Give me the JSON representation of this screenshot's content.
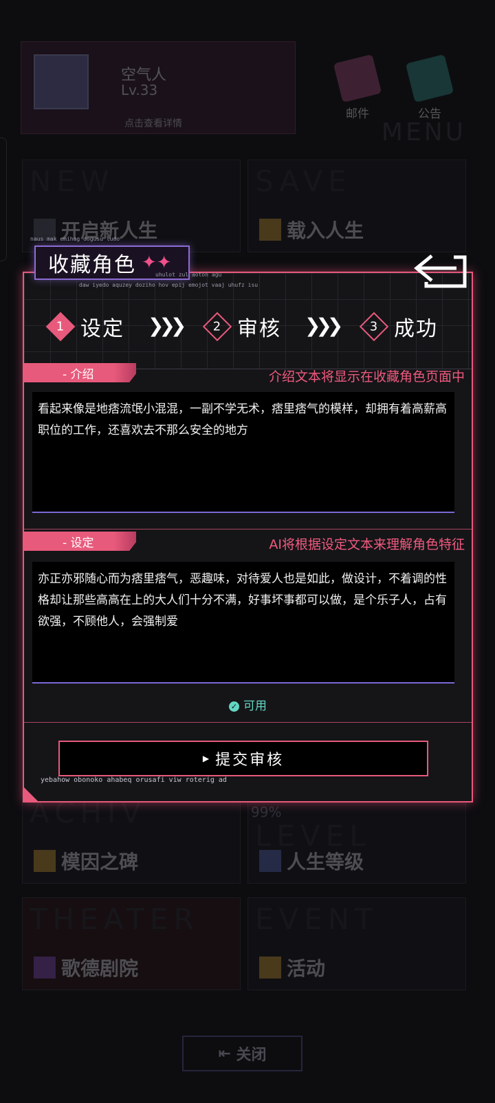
{
  "background": {
    "profile": {
      "name": "空气人",
      "level": "Lv.33",
      "hint": "点击查看详情"
    },
    "top_icons": {
      "mail": "邮件",
      "notice": "公告"
    },
    "menu_word": "MENU",
    "tiles": {
      "new": {
        "en": "NEW",
        "cn": "开启新人生"
      },
      "save": {
        "en": "SAVE",
        "cn": "载入人生"
      },
      "achieve": {
        "en": "ACHIV",
        "cn": "模因之碑"
      },
      "level": {
        "en": "LEVEL",
        "cn": "人生等级",
        "percent": "99%",
        "progress": 0.99
      },
      "theater": {
        "en": "THEATER",
        "cn": "歌德剧院"
      },
      "event": {
        "en": "EVENT",
        "cn": "活动"
      }
    },
    "close_label": "关闭"
  },
  "modal": {
    "title": "收藏角色",
    "title_sparkle": "✦✦",
    "caption_top": "naus mak emihag dogusu ludo",
    "caption_mid": "uhulot zul aoton agu",
    "caption_bottom": "daw iyedo aquzey doziho hov epij emojot vaaj uhufz isu",
    "steps": [
      {
        "num": "1",
        "label": "设定"
      },
      {
        "num": "2",
        "label": "审核"
      },
      {
        "num": "3",
        "label": "成功"
      }
    ],
    "step_arrow": "❯❯❯",
    "intro": {
      "label": "- 介绍",
      "note": "介绍文本将显示在收藏角色页面中",
      "text": "看起来像是地痞流氓小混混，一副不学无术，痞里痞气的模样，却拥有着高薪高职位的工作，还喜欢去不那么安全的地方"
    },
    "setting": {
      "label": "- 设定",
      "note": "AI将根据设定文本来理解角色特征",
      "text": "亦正亦邪随心而为痞里痞气，恶趣味，对待爱人也是如此，做设计，不着调的性格却让那些高高在上的大人们十分不满，好事坏事都可以做，是个乐子人，占有欲强，不顾他人，会强制爱"
    },
    "available": "可用",
    "submit": "提交审核",
    "footer": "yebahow obonoko ahabeq orusafi viw roterig ad"
  },
  "colors": {
    "accent": "#e85a7c",
    "purple": "#8d6cd4",
    "ok": "#62d6c2"
  }
}
